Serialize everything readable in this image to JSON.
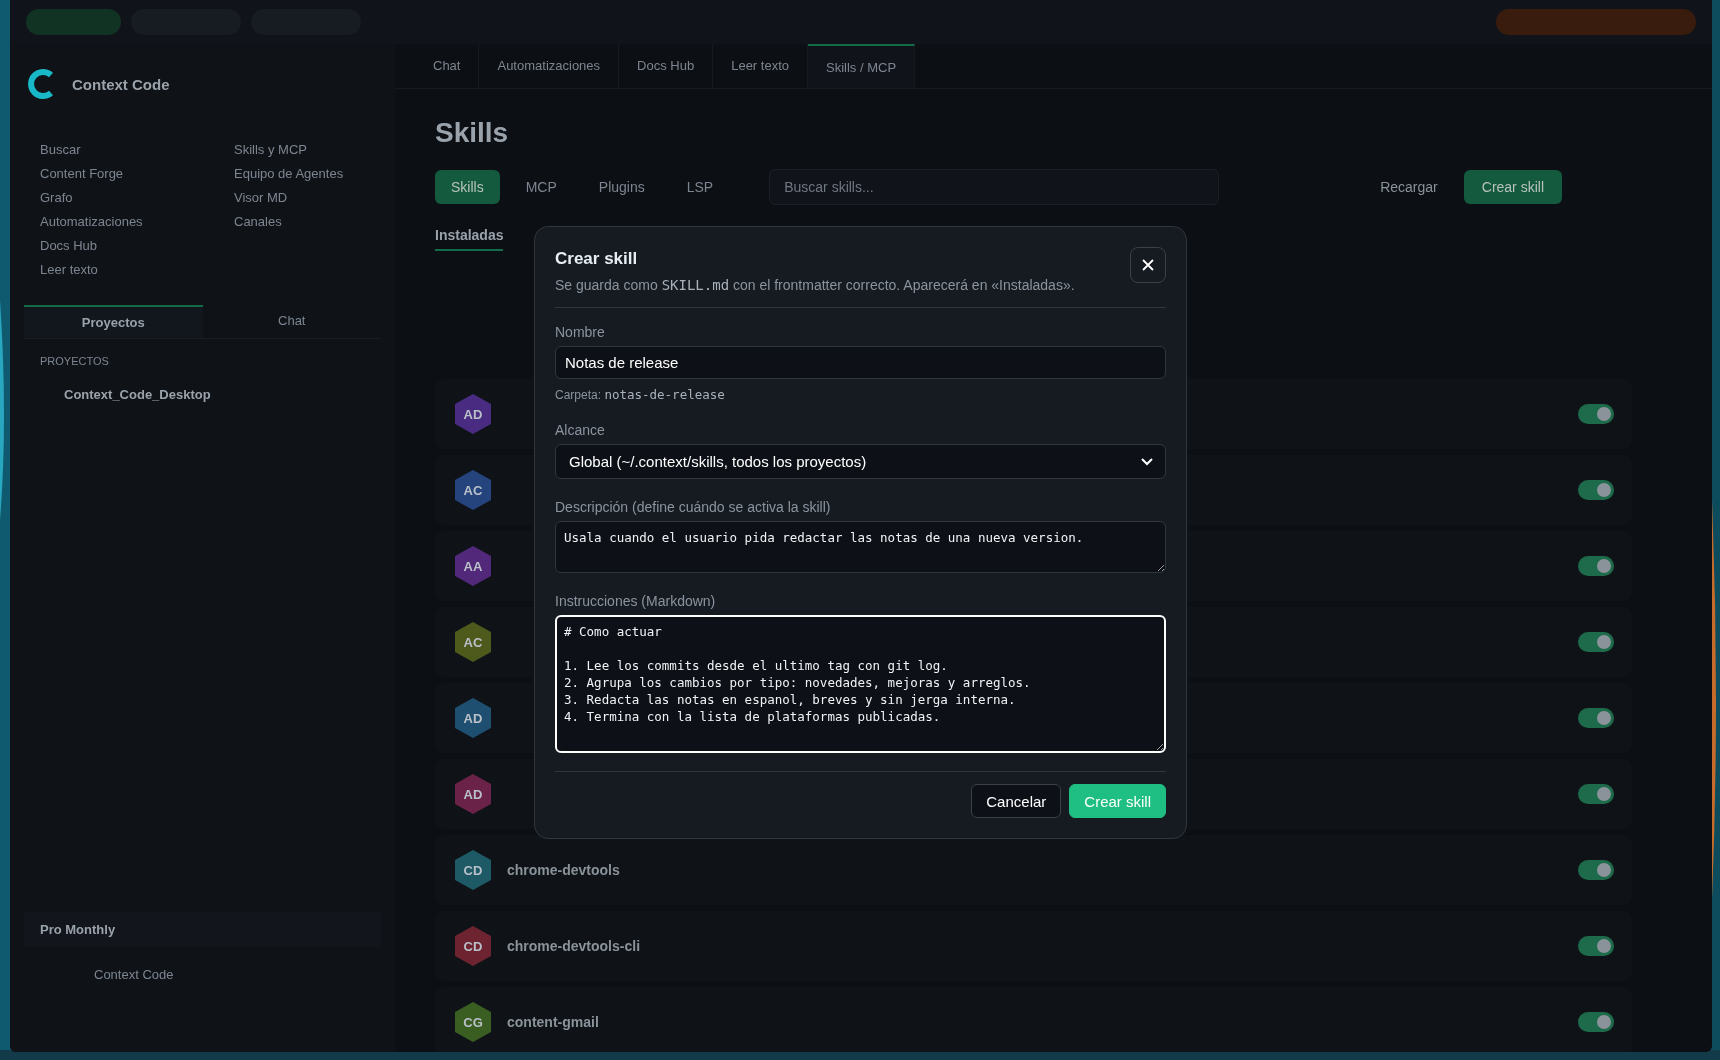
{
  "sidebar": {
    "title": "Context Code",
    "nav": [
      {
        "label": "Buscar"
      },
      {
        "label": "Content Forge"
      },
      {
        "label": "Grafo"
      },
      {
        "label": "Automatizaciones"
      },
      {
        "label": "Docs Hub"
      },
      {
        "label": "Leer texto"
      }
    ],
    "nav_right": [
      {
        "label": "Skills y MCP"
      },
      {
        "label": "Equipo de Agentes"
      },
      {
        "label": "Visor MD"
      },
      {
        "label": "Canales"
      }
    ],
    "panel_tabs": [
      {
        "label": "Proyectos",
        "selected": true
      },
      {
        "label": "Chat",
        "selected": false
      }
    ],
    "projects_header": "PROYECTOS",
    "projects": [
      {
        "name": "Context_Code_Desktop"
      }
    ],
    "plan": "Pro Monthly",
    "footer": "Context Code"
  },
  "tabs": [
    {
      "label": "Chat",
      "selected": false
    },
    {
      "label": "Automatizaciones",
      "selected": false
    },
    {
      "label": "Docs Hub",
      "selected": false
    },
    {
      "label": "Leer texto",
      "selected": false
    },
    {
      "label": "Skills / MCP",
      "selected": true
    }
  ],
  "page": {
    "title": "Skills",
    "sections": [
      {
        "label": "Skills",
        "selected": true
      },
      {
        "label": "MCP",
        "selected": false
      },
      {
        "label": "Plugins",
        "selected": false
      },
      {
        "label": "LSP",
        "selected": false
      }
    ],
    "search": {
      "placeholder": "Buscar skills..."
    },
    "reload": "Recargar",
    "create": "Crear skill",
    "subtabs": [
      {
        "label": "Instaladas",
        "selected": true
      }
    ],
    "skills": [
      {
        "initials": "AD",
        "color": "#4a2b82",
        "on": true
      },
      {
        "initials": "AC",
        "color": "#25447e",
        "on": true
      },
      {
        "initials": "AA",
        "color": "#52287a",
        "on": true
      },
      {
        "initials": "AC",
        "color": "#4e5a1c",
        "on": true
      },
      {
        "initials": "AD",
        "color": "#1f4f70",
        "on": true
      },
      {
        "initials": "AD",
        "color": "#6a2248",
        "on": true
      },
      {
        "initials": "CD",
        "color": "#1d5a66",
        "name": "chrome-devtools",
        "on": true
      },
      {
        "initials": "CD",
        "color": "#6e2430",
        "name": "chrome-devtools-cli",
        "on": true
      },
      {
        "initials": "CG",
        "color": "#3a5e22",
        "name": "content-gmail",
        "on": true
      }
    ]
  },
  "dialog": {
    "title": "Crear skill",
    "subtitle": {
      "before": "Se guarda como",
      "code": "SKILL.md",
      "after": "con el frontmatter correcto. Aparecerá en «Instaladas»."
    },
    "name": {
      "label": "Nombre",
      "value": "Notas de release"
    },
    "folder": {
      "label": "Carpeta:",
      "value": "notas-de-release"
    },
    "scope": {
      "label": "Alcance",
      "value": "Global (~/.context/skills, todos los proyectos)"
    },
    "description": {
      "label": "Descripción (define cuándo se activa la skill)",
      "value": "Usala cuando el usuario pida redactar las notas de una nueva version."
    },
    "instructions": {
      "label": "Instrucciones (Markdown)",
      "focused": true,
      "value": "# Como actuar\n\n1. Lee los commits desde el ultimo tag con git log.\n2. Agrupa los cambios por tipo: novedades, mejoras y arreglos.\n3. Redacta las notas en espanol, breves y sin jerga interna.\n4. Termina con la lista de plataformas publicadas."
    },
    "cancel": "Cancelar",
    "submit": "Crear skill"
  }
}
